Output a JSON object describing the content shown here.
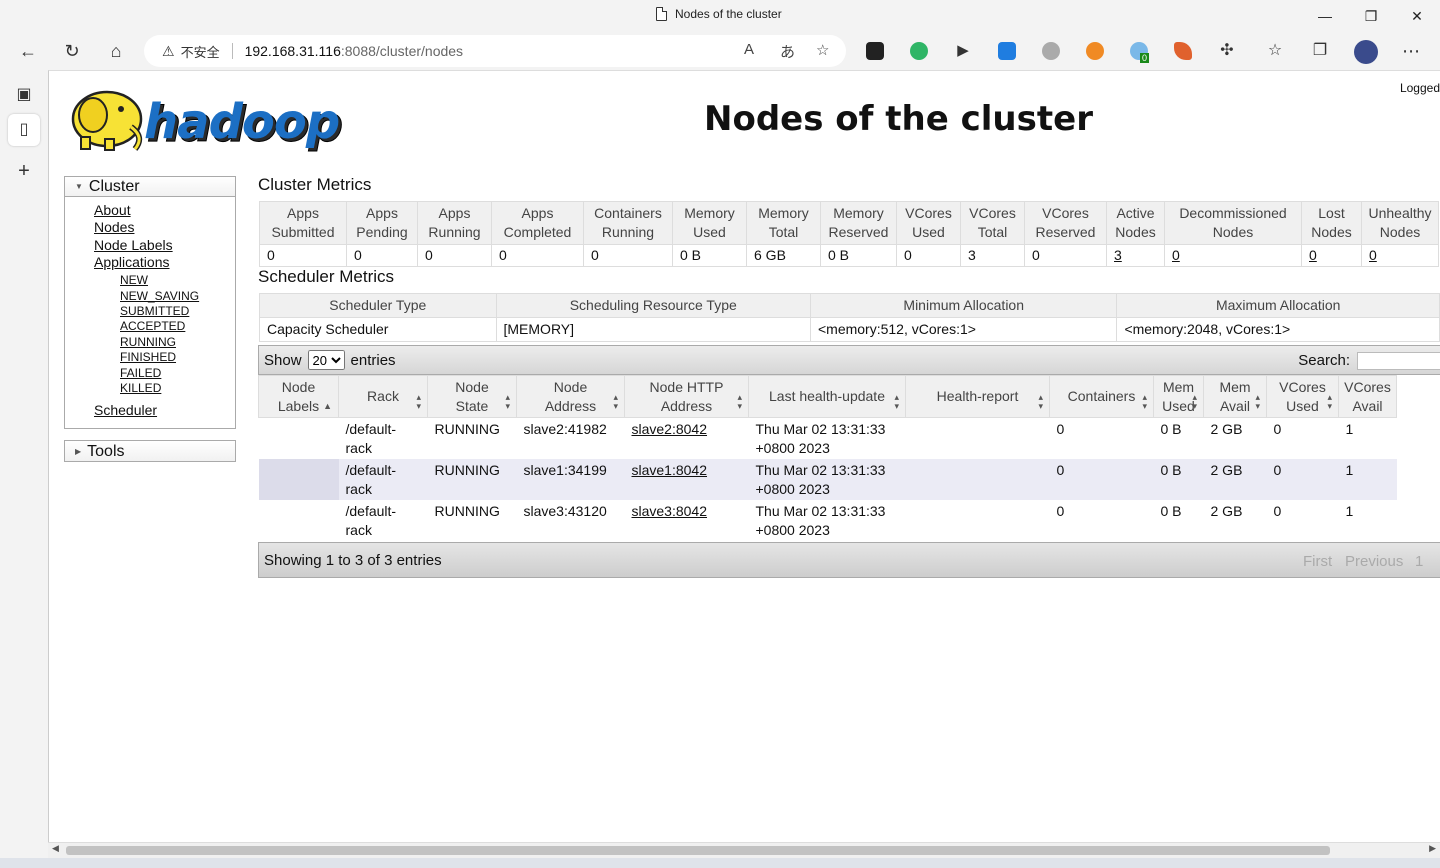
{
  "browser": {
    "tab_title": "Nodes of the cluster",
    "window_controls": {
      "minimize": "—",
      "restore": "❐",
      "close": "✕"
    },
    "address": {
      "security_label": "不安全",
      "host": "192.168.31.116",
      "path": ":8088/cluster/nodes"
    },
    "badge_count": "0"
  },
  "page": {
    "logged_in_text": "Logged",
    "title": "Nodes of the cluster",
    "logo_text": "hadoop"
  },
  "nav": {
    "cluster_header": "Cluster",
    "about": "About",
    "nodes": "Nodes",
    "node_labels": "Node Labels",
    "applications": "Applications",
    "app_states": [
      "NEW",
      "NEW_SAVING",
      "SUBMITTED",
      "ACCEPTED",
      "RUNNING",
      "FINISHED",
      "FAILED",
      "KILLED"
    ],
    "scheduler": "Scheduler",
    "tools_header": "Tools"
  },
  "cluster_metrics": {
    "title": "Cluster Metrics",
    "headers": [
      [
        "Apps",
        "Submitted"
      ],
      [
        "Apps",
        "Pending"
      ],
      [
        "Apps",
        "Running"
      ],
      [
        "Apps",
        "Completed"
      ],
      [
        "Containers",
        "Running"
      ],
      [
        "Memory",
        "Used"
      ],
      [
        "Memory",
        "Total"
      ],
      [
        "Memory",
        "Reserved"
      ],
      [
        "VCores",
        "Used"
      ],
      [
        "VCores",
        "Total"
      ],
      [
        "VCores",
        "Reserved"
      ],
      [
        "Active",
        "Nodes"
      ],
      [
        "Decommissioned",
        "Nodes"
      ],
      [
        "Lost",
        "Nodes"
      ],
      [
        "Unhealthy",
        "Nodes"
      ]
    ],
    "values": [
      "0",
      "0",
      "0",
      "0",
      "0",
      "0 B",
      "6 GB",
      "0 B",
      "0",
      "3",
      "0",
      "3",
      "0",
      "0",
      "0"
    ]
  },
  "scheduler_metrics": {
    "title": "Scheduler Metrics",
    "headers": [
      "Scheduler Type",
      "Scheduling Resource Type",
      "Minimum Allocation",
      "Maximum Allocation"
    ],
    "values": [
      "Capacity Scheduler",
      "[MEMORY]",
      "<memory:512, vCores:1>",
      "<memory:2048, vCores:1>"
    ]
  },
  "nodes_table": {
    "show_label": "Show",
    "page_size": "20",
    "entries_label": "entries",
    "search_label": "Search:",
    "headers": [
      [
        "Node",
        "Labels"
      ],
      [
        "Rack",
        ""
      ],
      [
        "Node",
        "State"
      ],
      [
        "Node",
        "Address"
      ],
      [
        "Node HTTP",
        "Address"
      ],
      [
        "Last health-update",
        ""
      ],
      [
        "Health-report",
        ""
      ],
      [
        "Containers",
        ""
      ],
      [
        "Mem",
        "Used"
      ],
      [
        "Mem",
        "Avail"
      ],
      [
        "VCores",
        "Used"
      ],
      [
        "VCores",
        "Avail"
      ]
    ],
    "rows": [
      {
        "labels": "",
        "rack1": "/default-",
        "rack2": "rack",
        "state": "RUNNING",
        "address": "slave2:41982",
        "http": "slave2:8042",
        "update1": "Thu Mar 02 13:31:33",
        "update2": "+0800 2023",
        "report": "",
        "containers": "0",
        "mem_used": "0 B",
        "mem_avail": "2 GB",
        "vc_used": "0",
        "vc_avail": "1"
      },
      {
        "labels": "",
        "rack1": "/default-",
        "rack2": "rack",
        "state": "RUNNING",
        "address": "slave1:34199",
        "http": "slave1:8042",
        "update1": "Thu Mar 02 13:31:33",
        "update2": "+0800 2023",
        "report": "",
        "containers": "0",
        "mem_used": "0 B",
        "mem_avail": "2 GB",
        "vc_used": "0",
        "vc_avail": "1"
      },
      {
        "labels": "",
        "rack1": "/default-",
        "rack2": "rack",
        "state": "RUNNING",
        "address": "slave3:43120",
        "http": "slave3:8042",
        "update1": "Thu Mar 02 13:31:33",
        "update2": "+0800 2023",
        "report": "",
        "containers": "0",
        "mem_used": "0 B",
        "mem_avail": "2 GB",
        "vc_used": "0",
        "vc_avail": "1"
      }
    ],
    "info": "Showing 1 to 3 of 3 entries",
    "pagination": {
      "first": "First",
      "previous": "Previous",
      "page": "1"
    }
  }
}
